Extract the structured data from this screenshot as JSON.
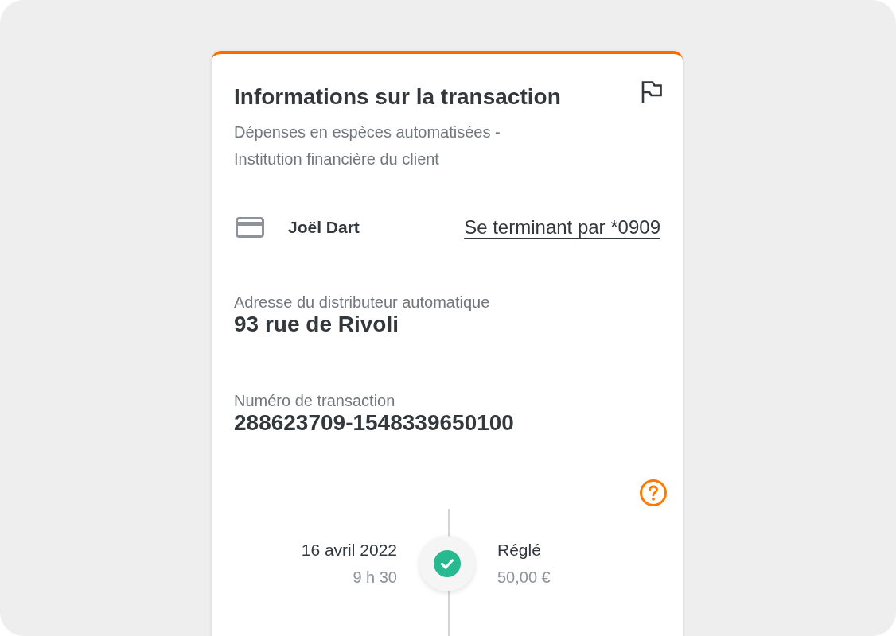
{
  "card": {
    "title": "Informations sur la transaction",
    "subtitle": "Dépenses en espèces automatisées - Institution financière du client",
    "account": {
      "holder": "Joël Dart",
      "card_ending": "Se terminant par *0909"
    },
    "fields": [
      {
        "label": "Adresse du distributeur automatique",
        "value": "93 rue de Rivoli"
      },
      {
        "label": "Numéro de transaction",
        "value": "288623709-1548339650100"
      }
    ],
    "timeline": [
      {
        "date": "16 avril 2022",
        "time": "9 h 30",
        "status": "Réglé",
        "amount": "50,00 €",
        "settled": true
      }
    ]
  }
}
